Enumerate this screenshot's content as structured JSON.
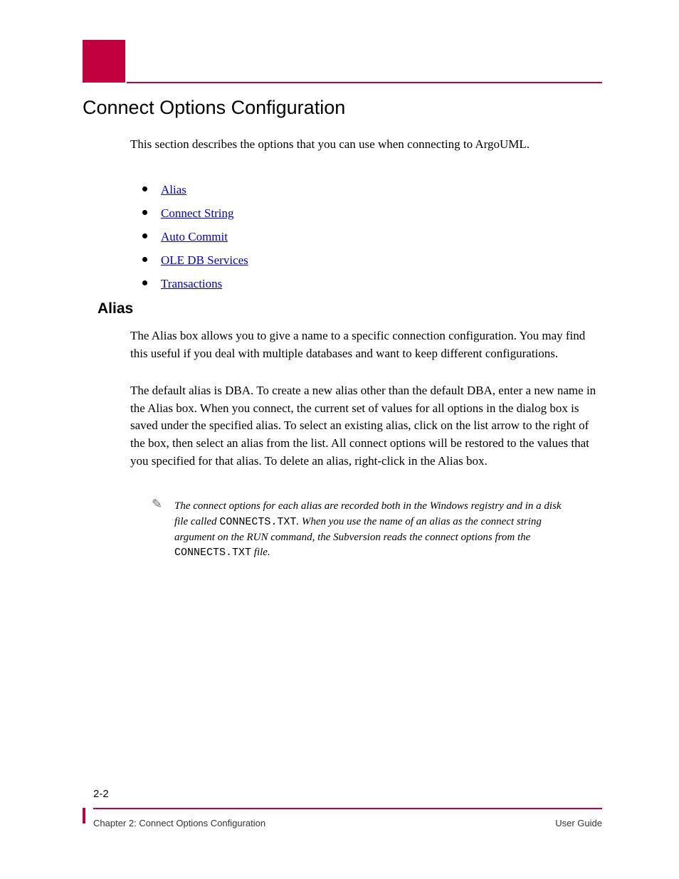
{
  "header": {
    "title": "Connect Options Configuration",
    "intro": "This section describes the options that you can use when connecting to ArgoUML."
  },
  "links": [
    {
      "label": "Alias",
      "href": "#alias"
    },
    {
      "label": "Connect String",
      "href": "#connect-string"
    },
    {
      "label": "Auto Commit",
      "href": "#auto-commit"
    },
    {
      "label": "OLE DB Services",
      "href": "#oledb-services"
    },
    {
      "label": "Transactions",
      "href": "#transactions"
    }
  ],
  "alias": {
    "heading": "Alias",
    "p1": "The Alias box allows you to give a name to a specific connection configuration. You may find this useful if you deal with multiple databases and want to keep different configurations.",
    "p2": "The default alias is DBA. To create a new alias other than the default DBA, enter a new name in the Alias box. When you connect, the current set of values for all options in the dialog box is saved under the specified alias. To select an existing alias, click on the list arrow to the right of the box, then select an alias from the list. All connect options will be restored to the values that you specified for that alias. To delete an alias, right-click in the Alias box.",
    "note": "The connect options for each alias are recorded both in the Windows registry and in a disk file called CONNECTS.TXT. When you use the name of an alias as the connect string argument on the RUN command, the Subversion reads the connect options from the CONNECTS.TXT file."
  },
  "footer": {
    "page_number": "2-2",
    "org_left": "Chapter 2: Connect Options Configuration",
    "org_right": "User Guide",
    "copyright": "",
    "doc_title": ""
  }
}
